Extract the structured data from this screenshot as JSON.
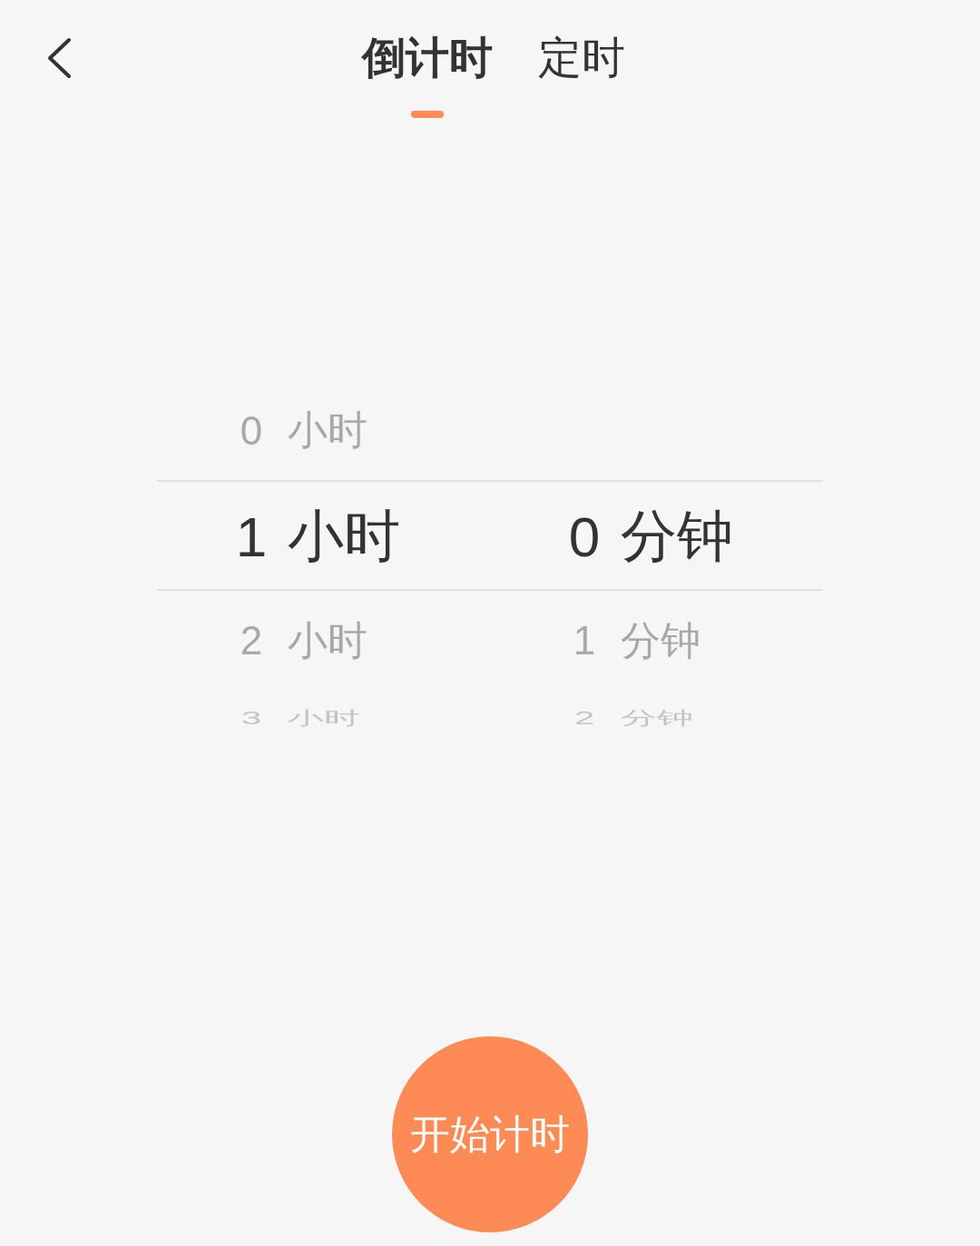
{
  "tabs": [
    {
      "label": "倒计时",
      "selected": true
    },
    {
      "label": "定时",
      "selected": false
    }
  ],
  "picker": {
    "columns": [
      {
        "items": [
          {
            "number": "0",
            "unit": "小时",
            "selected": false
          },
          {
            "number": "1",
            "unit": "小时",
            "selected": true
          },
          {
            "number": "2",
            "unit": "小时",
            "selected": false
          },
          {
            "number": "3",
            "unit": "小时",
            "selected": false
          }
        ]
      },
      {
        "items": [
          {
            "number": "0",
            "unit": "分钟",
            "selected": true
          },
          {
            "number": "1",
            "unit": "分钟",
            "selected": false
          },
          {
            "number": "2",
            "unit": "分钟",
            "selected": false
          }
        ]
      }
    ]
  },
  "start_button": {
    "label": "开始计时"
  }
}
